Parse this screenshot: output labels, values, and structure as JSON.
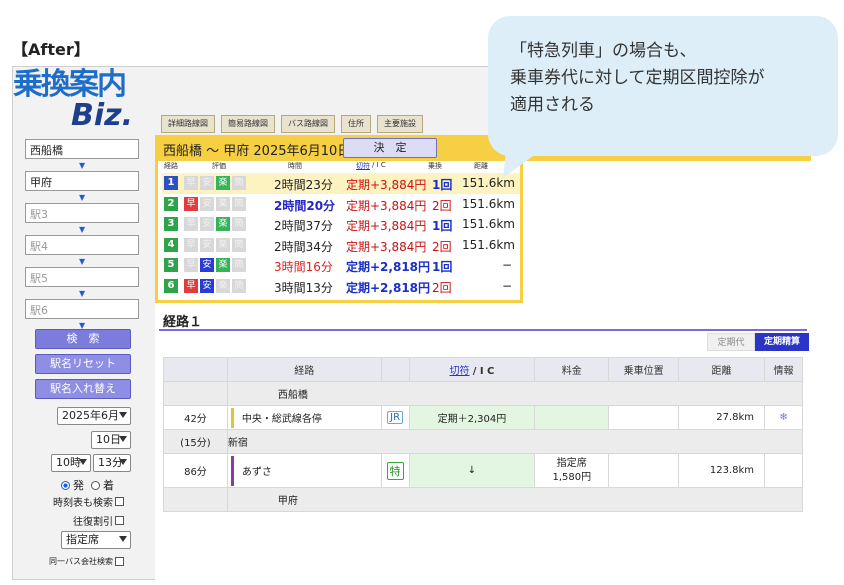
{
  "label": "【After】",
  "callout": {
    "lines": [
      "「特急列車」の場合も、",
      "乗車券代に対して定期区間控除が",
      "適用される"
    ]
  },
  "logo": {
    "top": "乗換案内",
    "bottom": "Biz."
  },
  "sidebar": {
    "stations": [
      "西船橋",
      "甲府",
      "駅3",
      "駅4",
      "駅5",
      "駅6"
    ],
    "search_button": "検　索",
    "reset_button": "駅名リセット",
    "swap_button": "駅名入れ替え",
    "month_select": "2025年6月",
    "day_select": "10日",
    "hour_select": "10時",
    "minute_select": "13分",
    "radio_depart": "発",
    "radio_arrive": "着",
    "timetable_check": "時刻表も検索",
    "roundtrip_check": "往復割引",
    "seat_select": "指定席",
    "bus_check": "同一バス会社検索"
  },
  "tabs": [
    "詳細路線図",
    "簡易路線図",
    "バス路線図",
    "住所",
    "主要施設"
  ],
  "result": {
    "title": "西船橋 〜 甲府 2025年6月10日",
    "decide_button": "決　定",
    "col_heads": {
      "route": "経路",
      "eval": "評価",
      "time": "時間",
      "fare_link": "切符",
      "fare_ic": "/ I C",
      "transfer": "乗換",
      "distance": "距離"
    },
    "eval_labels": {
      "fast": "早",
      "safe": "安",
      "easy": "楽",
      "cheap": "簡"
    },
    "routes": [
      {
        "num": "1",
        "color": "#2a52c8",
        "fast": false,
        "safe": false,
        "easy": true,
        "time": "2時間23分",
        "fare": "定期+3,884円",
        "transfer": "1回",
        "distance": "151.6km"
      },
      {
        "num": "2",
        "color": "#2fa34a",
        "fast": true,
        "safe": false,
        "easy": false,
        "time": "2時間20分",
        "fare": "定期+3,884円",
        "transfer": "2回",
        "distance": "151.6km"
      },
      {
        "num": "3",
        "color": "#2fa34a",
        "fast": false,
        "safe": false,
        "easy": true,
        "time": "2時間37分",
        "fare": "定期+3,884円",
        "transfer": "1回",
        "distance": "151.6km"
      },
      {
        "num": "4",
        "color": "#2fa34a",
        "fast": false,
        "safe": false,
        "easy": false,
        "time": "2時間34分",
        "fare": "定期+3,884円",
        "transfer": "2回",
        "distance": "151.6km"
      },
      {
        "num": "5",
        "color": "#2fa34a",
        "fast": false,
        "safe": true,
        "easy": true,
        "time": "3時間16分",
        "fare": "定期+2,818円",
        "transfer": "1回",
        "distance": "−"
      },
      {
        "num": "6",
        "color": "#2fa34a",
        "fast": true,
        "safe": true,
        "easy": false,
        "time": "3時間13分",
        "fare": "定期+2,818円",
        "transfer": "2回",
        "distance": "−"
      }
    ]
  },
  "route_detail": {
    "label": "経路１",
    "toggle_off": "定期代",
    "toggle_on": "定期精算",
    "headers": {
      "route": "経路",
      "fare_link": "切符",
      "fare_ic": "/ I C",
      "charge": "料金",
      "position": "乗車位置",
      "distance": "距離",
      "info": "情報"
    },
    "start_station": "西船橋",
    "seg1": {
      "minutes": "42分",
      "line": "中央・総武線各停",
      "badge": "JR",
      "fare": "定期＋2,304円",
      "distance": "27.8km",
      "info_icon": "snowflake-icon"
    },
    "transfer": {
      "wait": "(15分)",
      "station": "新宿"
    },
    "seg2": {
      "minutes": "86分",
      "line": "あずさ",
      "badge": "特",
      "fare": "↓",
      "charge_line1": "指定席",
      "charge_line2": "1,580円",
      "distance": "123.8km"
    },
    "end_station": "甲府"
  },
  "colors": {
    "accent_yellow": "#f7cf43",
    "purple_button": "#7c7cdc",
    "toggle_blue": "#2a35c8",
    "line_chuo": "#e3c430",
    "line_azusa": "#8a3aa8"
  }
}
